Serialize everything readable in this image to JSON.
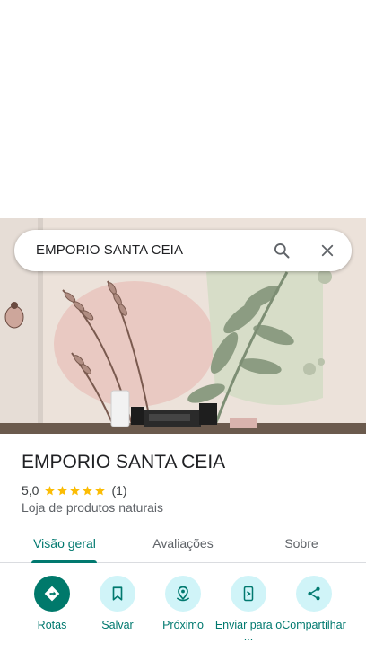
{
  "search": {
    "query": "EMPORIO SANTA CEIA"
  },
  "icons": {
    "search": "search-icon",
    "close": "close-icon",
    "directions": "directions-icon",
    "save": "bookmark-icon",
    "nearby": "nearby-pin-icon",
    "send": "send-to-phone-icon",
    "share": "share-icon",
    "star": "star-icon"
  },
  "place": {
    "name": "EMPORIO SANTA CEIA",
    "rating": "5,0",
    "stars": 5,
    "review_count": "(1)",
    "category": "Loja de produtos naturais"
  },
  "tabs": [
    {
      "label": "Visão geral",
      "active": true
    },
    {
      "label": "Avaliações",
      "active": false
    },
    {
      "label": "Sobre",
      "active": false
    }
  ],
  "actions": [
    {
      "label": "Rotas"
    },
    {
      "label": "Salvar"
    },
    {
      "label": "Próximo"
    },
    {
      "label": "Enviar para o ..."
    },
    {
      "label": "Compartilhar"
    }
  ],
  "colors": {
    "accent": "#01796f",
    "action_bg": "#d0f4f8",
    "primary_action_bg": "#00796b",
    "star": "#fbbc04"
  }
}
